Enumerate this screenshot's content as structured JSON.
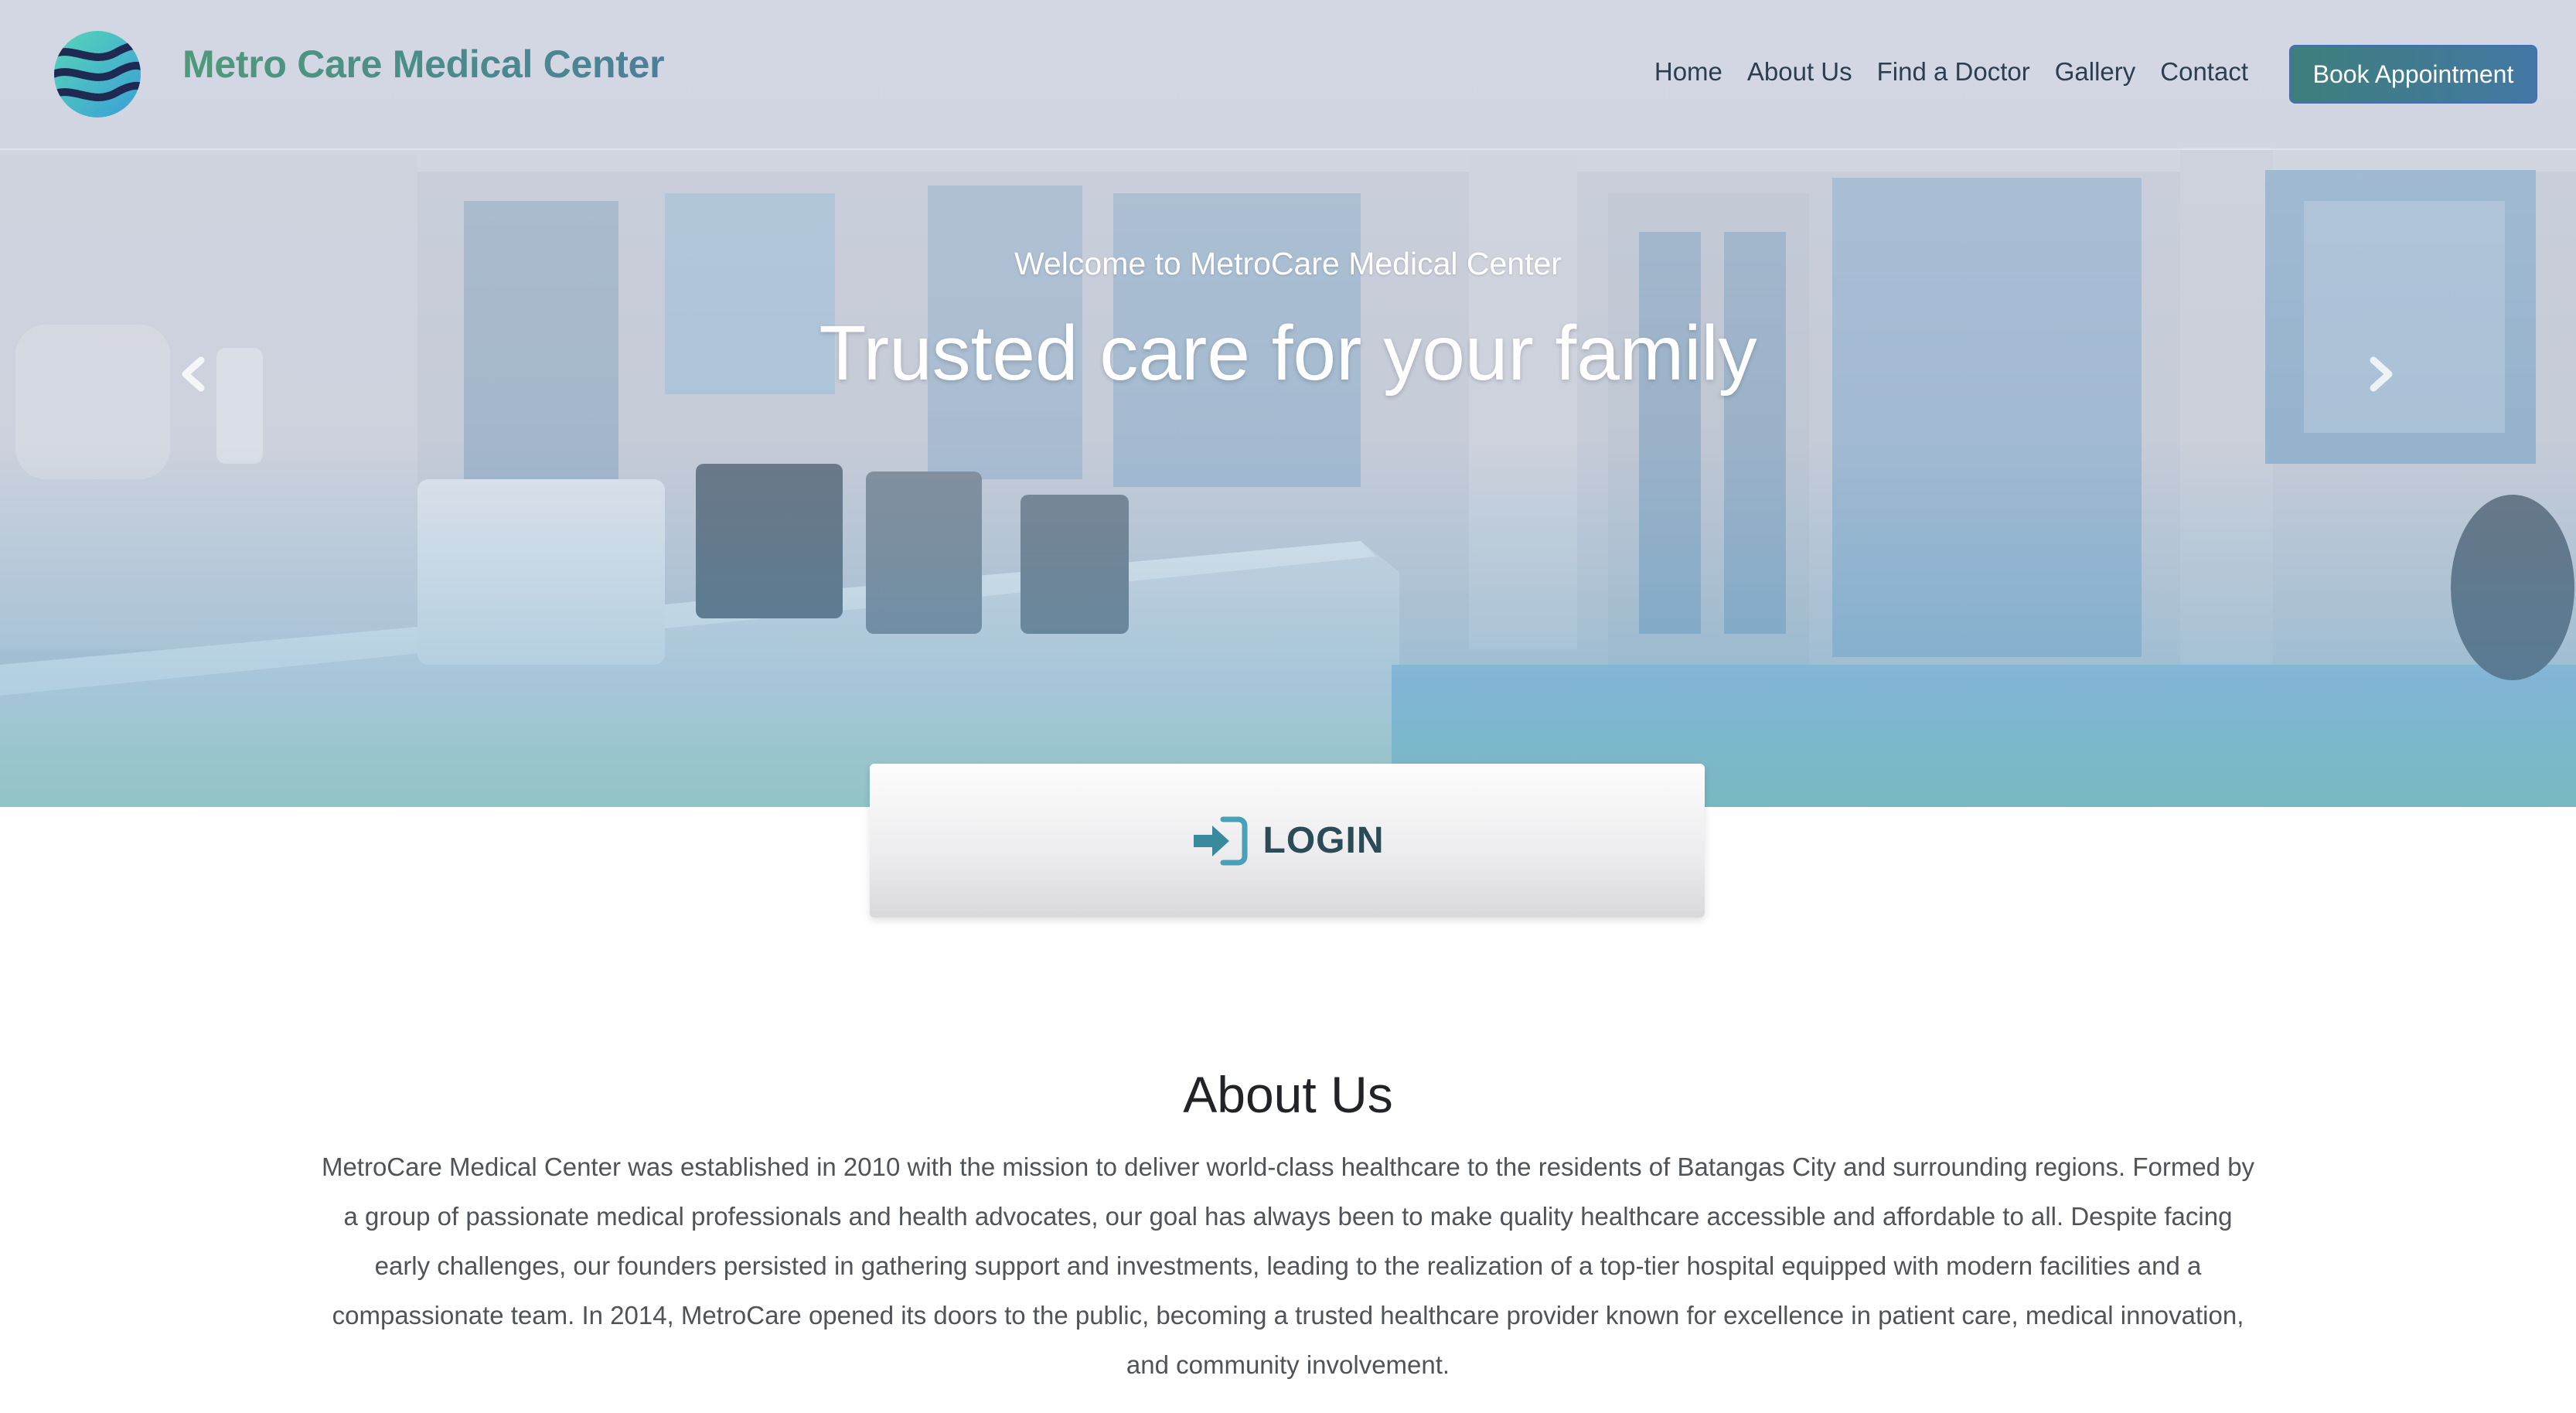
{
  "navbar": {
    "brand": "Metro Care Medical Center",
    "links": [
      "Home",
      "About Us",
      "Find a Doctor",
      "Gallery",
      "Contact"
    ],
    "cta": "Book Appointment"
  },
  "hero": {
    "subtitle": "Welcome to MetroCare Medical Center",
    "title": "Trusted care for your family"
  },
  "login": {
    "label": "LOGIN"
  },
  "about": {
    "title": "About Us",
    "body": "MetroCare Medical Center was established in 2010 with the mission to deliver world-class healthcare to the residents of Batangas City and surrounding regions. Formed by a group of passionate medical professionals and health advocates, our goal has always been to make quality healthcare accessible and affordable to all. Despite facing early challenges, our founders persisted in gathering support and investments, leading to the realization of a top-tier hospital equipped with modern facilities and a compassionate team. In 2014, MetroCare opened its doors to the public, becoming a trusted healthcare provider known for excellence in patient care, medical innovation, and community involvement."
  },
  "colors": {
    "brand_green": "#4f9a7a",
    "nav_text": "#2c3e50",
    "cta_start": "#3e7f7c",
    "cta_end": "#4378a4",
    "login_text": "#2b4c57",
    "login_icon": "#3a8a9e"
  }
}
